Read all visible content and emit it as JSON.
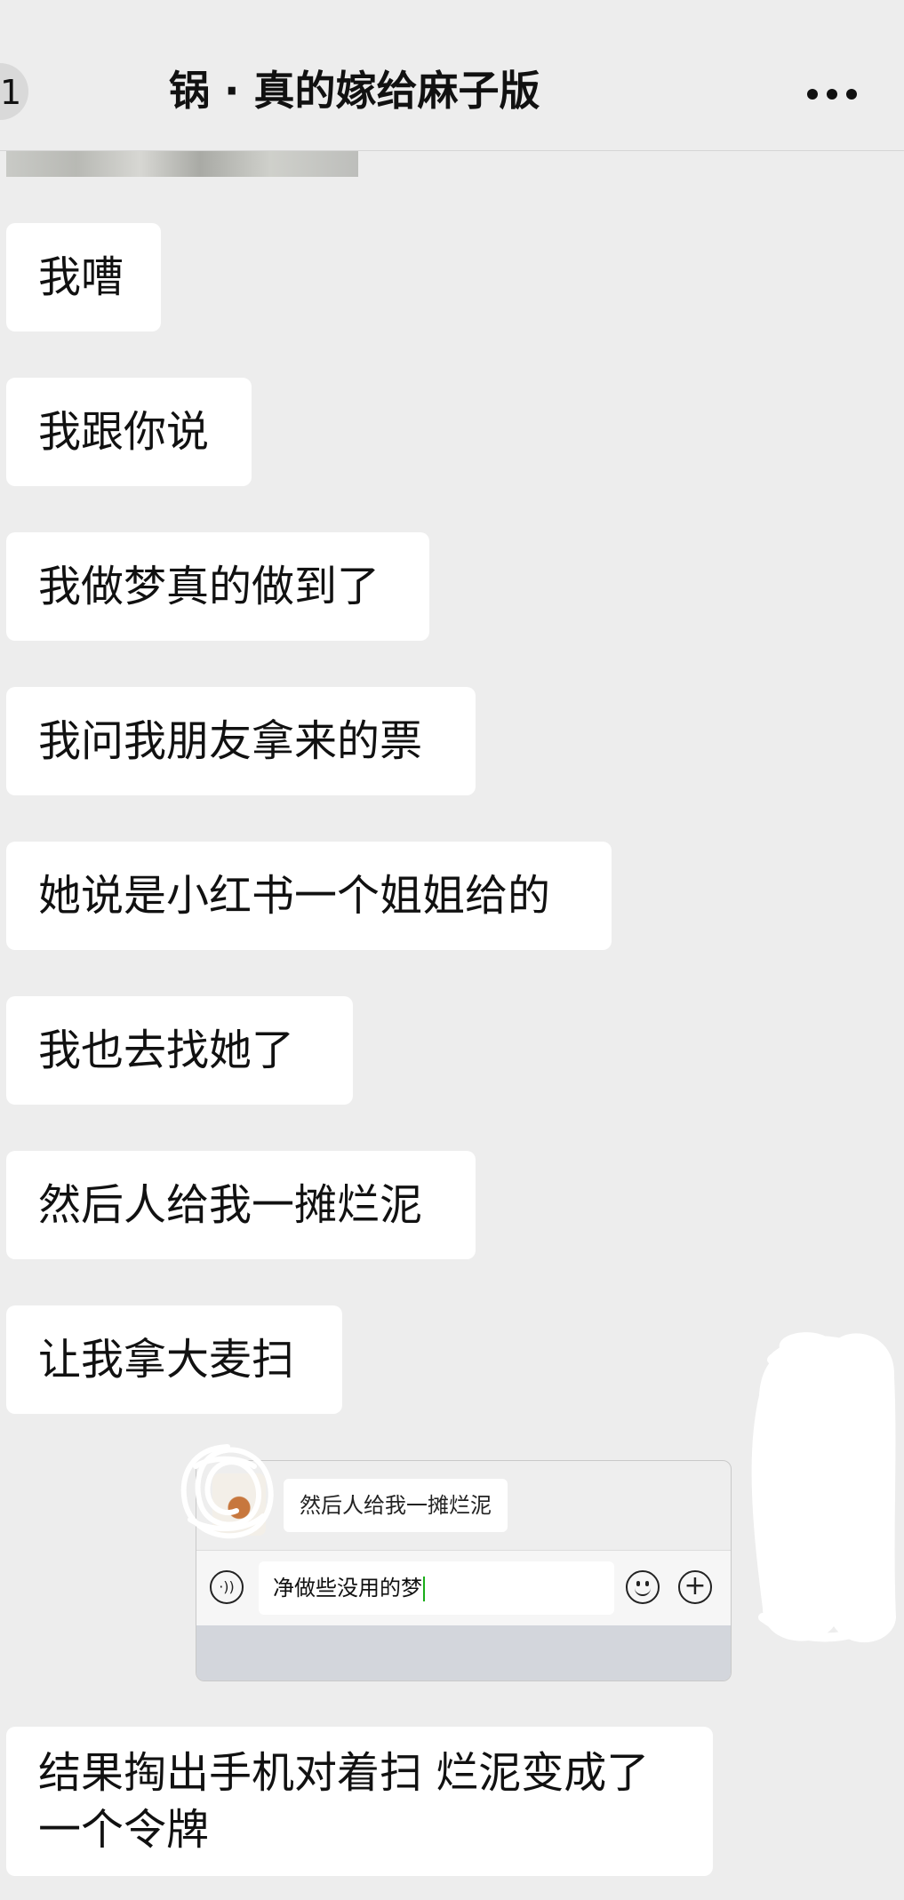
{
  "header": {
    "back_count": "1",
    "title": "锅 · 真的嫁给麻子版"
  },
  "icons": {
    "more": "more-icon",
    "voice": "voice-icon",
    "emoji": "emoji-icon",
    "plus": "plus-icon"
  },
  "messages": [
    "我嘈",
    "我跟你说",
    "我做梦真的做到了",
    "我问我朋友拿来的票",
    "她说是小红书一个姐姐给的",
    "我也去找她了",
    "然后人给我一摊烂泥",
    "让我拿大麦扫",
    "结果掏出手机对着扫 烂泥变成了一个令牌"
  ],
  "embedded_screenshot": {
    "quoted_message": "然后人给我一摊烂泥",
    "input_value": "净做些没用的梦",
    "voice_glyph": "·))",
    "plus_glyph": "+"
  },
  "colors": {
    "background": "#ededed",
    "bubble": "#ffffff",
    "caret": "#1aad19"
  }
}
